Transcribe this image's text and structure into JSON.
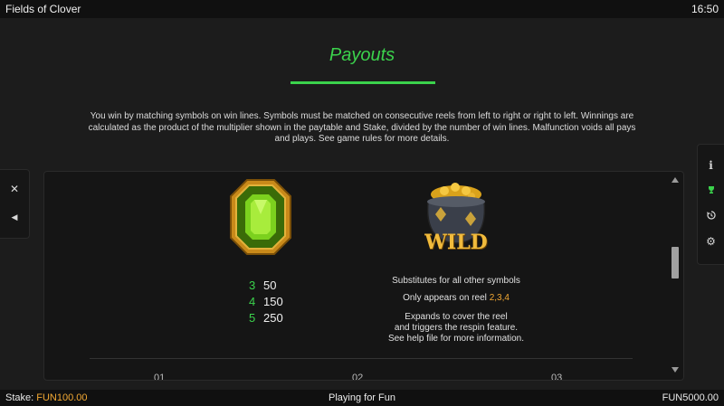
{
  "topbar": {
    "game_title": "Fields of Clover",
    "clock": "16:50"
  },
  "page": {
    "title": "Payouts",
    "intro": "You win by matching symbols on win lines. Symbols must be matched on consecutive reels from left to right or right to left. Winnings are calculated as the product of the multiplier shown in the paytable and Stake, divided by the number of win lines. Malfunction voids all pays and plays. See game rules for more details."
  },
  "emerald_paytable": [
    {
      "count": "3",
      "payout": "50"
    },
    {
      "count": "4",
      "payout": "150"
    },
    {
      "count": "5",
      "payout": "250"
    }
  ],
  "wild": {
    "label": "WILD",
    "line1": "Substitutes for all other symbols",
    "reels_prefix": "Only appears on reel ",
    "reels": "2,3,4",
    "line3": "Expands to cover the reel",
    "line4": "and triggers the respin feature.",
    "line5": "See help file for more information."
  },
  "next_symbols_partial": [
    "01",
    "02",
    "03"
  ],
  "left_controls": [
    {
      "icon": "close-icon"
    },
    {
      "icon": "back-icon"
    }
  ],
  "right_controls": [
    {
      "icon": "info-icon"
    },
    {
      "icon": "paytable-icon",
      "active": true
    },
    {
      "icon": "history-icon"
    },
    {
      "icon": "settings-icon"
    }
  ],
  "bottombar": {
    "stake_label": "Stake:",
    "stake_value": "FUN100.00",
    "mode": "Playing for Fun",
    "balance": "FUN5000.00"
  },
  "colors": {
    "accent_green": "#3bd24c",
    "accent_orange": "#f2a833",
    "background": "#1c1c1c"
  }
}
